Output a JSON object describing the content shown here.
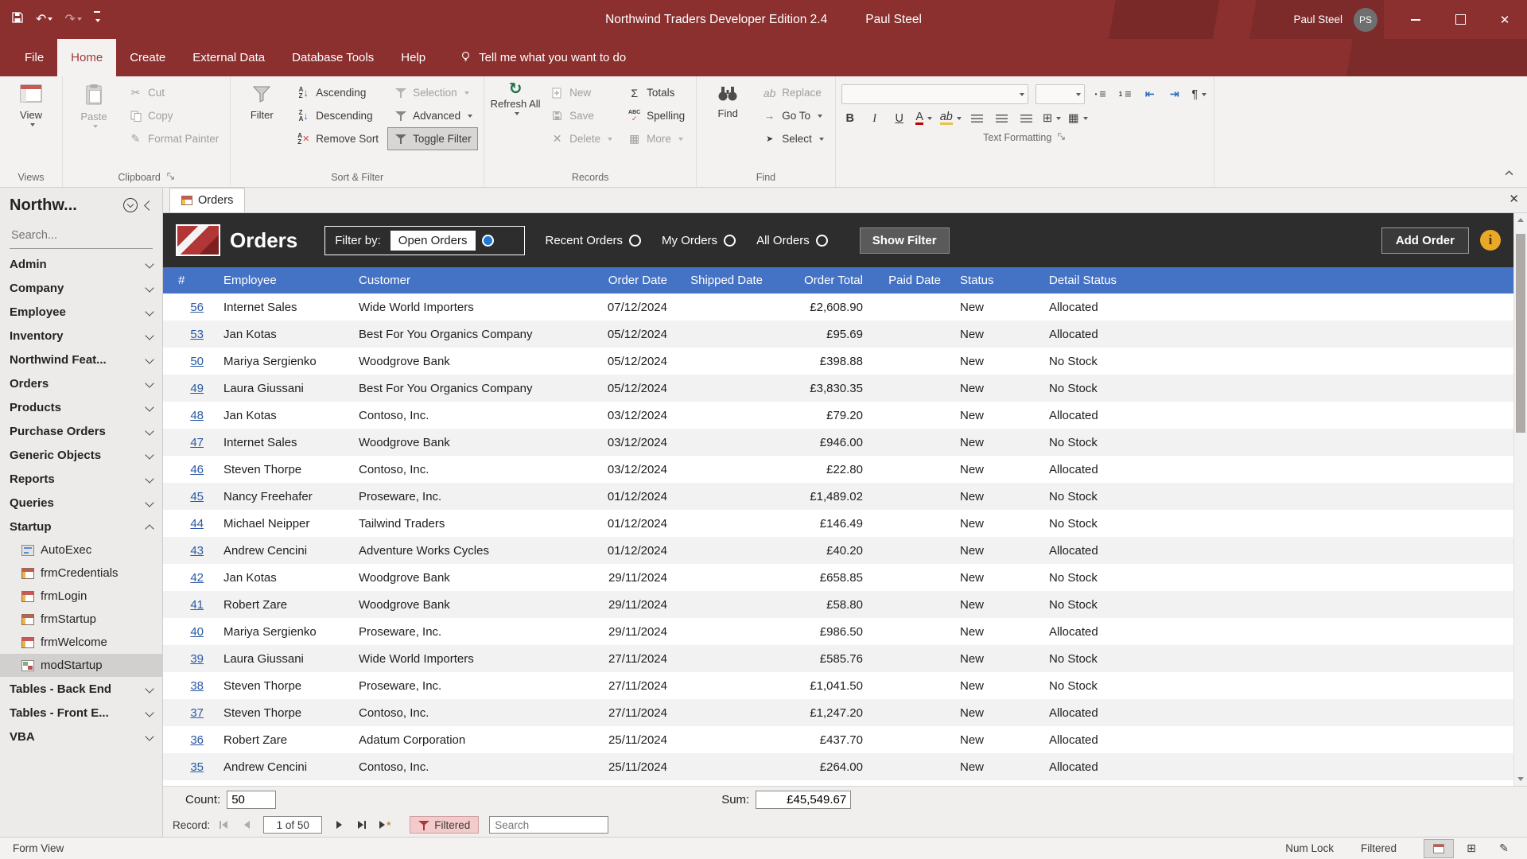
{
  "titlebar": {
    "title": "Northwind Traders Developer Edition  2.4",
    "title_user": "Paul Steel",
    "user_name": "Paul Steel",
    "avatar_initials": "PS"
  },
  "ribbon": {
    "tabs": {
      "file": "File",
      "home": "Home",
      "create": "Create",
      "external_data": "External Data",
      "database_tools": "Database Tools",
      "help": "Help"
    },
    "tell_me": "Tell me what you want to do",
    "groups": {
      "views": {
        "label": "Views",
        "view": "View"
      },
      "clipboard": {
        "label": "Clipboard",
        "paste": "Paste",
        "cut": "Cut",
        "copy": "Copy",
        "format_painter": "Format Painter"
      },
      "sort_filter": {
        "label": "Sort & Filter",
        "filter": "Filter",
        "ascending": "Ascending",
        "descending": "Descending",
        "remove_sort": "Remove Sort",
        "selection": "Selection",
        "advanced": "Advanced",
        "toggle_filter": "Toggle Filter"
      },
      "records": {
        "label": "Records",
        "refresh_all": "Refresh All",
        "new": "New",
        "save": "Save",
        "delete": "Delete",
        "totals": "Totals",
        "spelling": "Spelling",
        "more": "More"
      },
      "find": {
        "label": "Find",
        "find": "Find",
        "replace": "Replace",
        "go_to": "Go To",
        "select": "Select"
      },
      "text_formatting": {
        "label": "Text Formatting"
      }
    }
  },
  "icons": {
    "undo": "↶",
    "redo": "↷",
    "cut": "✂",
    "format_painter": "✎",
    "delete": "✕",
    "totals": "Σ",
    "spelling_abc": "ABC",
    "check": "✓",
    "more": "▦",
    "refresh": "↻",
    "replace": "ab",
    "go_to": "→",
    "select": "➤",
    "bold": "B",
    "italic": "I",
    "underline": "U",
    "font_color": "A",
    "highlight": "ab",
    "paragraph": "¶",
    "bullets": "≡",
    "numbering_digit": "1",
    "indent_left": "⇤",
    "indent_right": "⇥",
    "gridlines": "⊞",
    "shading": "▦",
    "close": "✕",
    "letter_a": "A",
    "letter_z": "Z",
    "arrow_down": "↓",
    "info": "i",
    "hash": "#"
  },
  "nav_pane": {
    "title": "Northw...",
    "search_placeholder": "Search...",
    "sections": [
      {
        "label": "Admin",
        "state": "collapsed"
      },
      {
        "label": "Company",
        "state": "collapsed"
      },
      {
        "label": "Employee",
        "state": "collapsed"
      },
      {
        "label": "Inventory",
        "state": "collapsed"
      },
      {
        "label": "Northwind Feat...",
        "state": "collapsed"
      },
      {
        "label": "Orders",
        "state": "collapsed"
      },
      {
        "label": "Products",
        "state": "collapsed"
      },
      {
        "label": "Purchase Orders",
        "state": "collapsed"
      },
      {
        "label": "Generic Objects",
        "state": "collapsed"
      },
      {
        "label": "Reports",
        "state": "collapsed"
      },
      {
        "label": "Queries",
        "state": "collapsed"
      },
      {
        "label": "Startup",
        "state": "expanded",
        "items": [
          {
            "label": "AutoExec",
            "icon": "ico-autoexec"
          },
          {
            "label": "frmCredentials",
            "icon": "ico-form"
          },
          {
            "label": "frmLogin",
            "icon": "ico-form"
          },
          {
            "label": "frmStartup",
            "icon": "ico-form"
          },
          {
            "label": "frmWelcome",
            "icon": "ico-form"
          },
          {
            "label": "modStartup",
            "icon": "ico-module",
            "selected": true
          }
        ]
      },
      {
        "label": "Tables - Back End",
        "state": "collapsed"
      },
      {
        "label": "Tables - Front E...",
        "state": "collapsed"
      },
      {
        "label": "VBA",
        "state": "collapsed"
      }
    ]
  },
  "document": {
    "tab": "Orders"
  },
  "form_header": {
    "title": "Orders",
    "filter_by_label": "Filter by:",
    "options": [
      {
        "label": "Open Orders",
        "selected": true
      },
      {
        "label": "Recent Orders",
        "selected": false
      },
      {
        "label": "My Orders",
        "selected": false
      },
      {
        "label": "All Orders",
        "selected": false
      }
    ],
    "show_filter": "Show Filter",
    "add_order": "Add Order"
  },
  "table": {
    "columns": [
      "#",
      "Employee",
      "Customer",
      "Order Date",
      "Shipped Date",
      "Order Total",
      "Paid Date",
      "Status",
      "Detail Status"
    ],
    "col_keys": [
      "id",
      "employee",
      "customer",
      "order_date",
      "shipped_date",
      "order_total",
      "paid_date",
      "status",
      "detail_status"
    ],
    "rows": [
      [
        "56",
        "Internet Sales",
        "Wide World Importers",
        "07/12/2024",
        "",
        "£2,608.90",
        "",
        "New",
        "Allocated"
      ],
      [
        "53",
        "Jan Kotas",
        "Best For You Organics Company",
        "05/12/2024",
        "",
        "£95.69",
        "",
        "New",
        "Allocated"
      ],
      [
        "50",
        "Mariya Sergienko",
        "Woodgrove Bank",
        "05/12/2024",
        "",
        "£398.88",
        "",
        "New",
        "No Stock"
      ],
      [
        "49",
        "Laura Giussani",
        "Best For You Organics Company",
        "05/12/2024",
        "",
        "£3,830.35",
        "",
        "New",
        "No Stock"
      ],
      [
        "48",
        "Jan Kotas",
        "Contoso, Inc.",
        "03/12/2024",
        "",
        "£79.20",
        "",
        "New",
        "Allocated"
      ],
      [
        "47",
        "Internet Sales",
        "Woodgrove Bank",
        "03/12/2024",
        "",
        "£946.00",
        "",
        "New",
        "No Stock"
      ],
      [
        "46",
        "Steven Thorpe",
        "Contoso, Inc.",
        "03/12/2024",
        "",
        "£22.80",
        "",
        "New",
        "Allocated"
      ],
      [
        "45",
        "Nancy Freehafer",
        "Proseware, Inc.",
        "01/12/2024",
        "",
        "£1,489.02",
        "",
        "New",
        "No Stock"
      ],
      [
        "44",
        "Michael Neipper",
        "Tailwind Traders",
        "01/12/2024",
        "",
        "£146.49",
        "",
        "New",
        "No Stock"
      ],
      [
        "43",
        "Andrew Cencini",
        "Adventure Works Cycles",
        "01/12/2024",
        "",
        "£40.20",
        "",
        "New",
        "Allocated"
      ],
      [
        "42",
        "Jan Kotas",
        "Woodgrove Bank",
        "29/11/2024",
        "",
        "£658.85",
        "",
        "New",
        "No Stock"
      ],
      [
        "41",
        "Robert Zare",
        "Woodgrove Bank",
        "29/11/2024",
        "",
        "£58.80",
        "",
        "New",
        "No Stock"
      ],
      [
        "40",
        "Mariya Sergienko",
        "Proseware, Inc.",
        "29/11/2024",
        "",
        "£986.50",
        "",
        "New",
        "Allocated"
      ],
      [
        "39",
        "Laura Giussani",
        "Wide World Importers",
        "27/11/2024",
        "",
        "£585.76",
        "",
        "New",
        "No Stock"
      ],
      [
        "38",
        "Steven Thorpe",
        "Proseware, Inc.",
        "27/11/2024",
        "",
        "£1,041.50",
        "",
        "New",
        "No Stock"
      ],
      [
        "37",
        "Steven Thorpe",
        "Contoso, Inc.",
        "27/11/2024",
        "",
        "£1,247.20",
        "",
        "New",
        "Allocated"
      ],
      [
        "36",
        "Robert Zare",
        "Adatum Corporation",
        "25/11/2024",
        "",
        "£437.70",
        "",
        "New",
        "Allocated"
      ],
      [
        "35",
        "Andrew Cencini",
        "Contoso, Inc.",
        "25/11/2024",
        "",
        "£264.00",
        "",
        "New",
        "Allocated"
      ]
    ]
  },
  "footer": {
    "count_label": "Count:",
    "count_value": "50",
    "sum_label": "Sum:",
    "sum_value": "£45,549.67"
  },
  "record_nav": {
    "record_label": "Record:",
    "position": "1 of 50",
    "filtered": "Filtered",
    "search_placeholder": "Search"
  },
  "status_bar": {
    "left": "Form View",
    "num_lock": "Num Lock",
    "filtered": "Filtered"
  },
  "colors": {
    "titlebar": "#8b2f2f",
    "accent_red": "#a4373a",
    "header_blue": "#4472c4",
    "selection_gray": "#d2d0ce",
    "filtered_pink": "#f5caca",
    "info_yellow": "#e9a827"
  }
}
